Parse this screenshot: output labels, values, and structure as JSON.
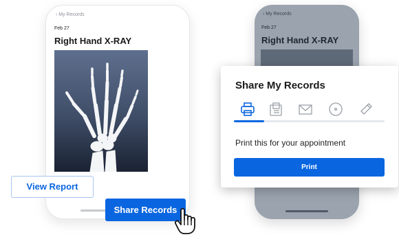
{
  "left_phone": {
    "back_label": "‹  My Records",
    "date": "Feb 27",
    "title": "Right Hand X-RAY"
  },
  "right_phone": {
    "back_label": "‹  My Records",
    "date": "Feb 27",
    "title": "Right Hand X-RAY"
  },
  "share_modal": {
    "title": "Share My Records",
    "options": [
      {
        "icon": "printer-icon"
      },
      {
        "icon": "fax-icon"
      },
      {
        "icon": "envelope-icon"
      },
      {
        "icon": "disc-icon"
      },
      {
        "icon": "usb-drive-icon"
      }
    ],
    "selected_index": 0,
    "progress_fraction": 0.2,
    "description": "Print this for your appointment",
    "print_label": "Print"
  },
  "actions": {
    "view_report_label": "View Report",
    "share_records_label": "Share Records"
  },
  "colors": {
    "accent": "#0a66e0",
    "dim_phone": "#9aa3ae"
  }
}
